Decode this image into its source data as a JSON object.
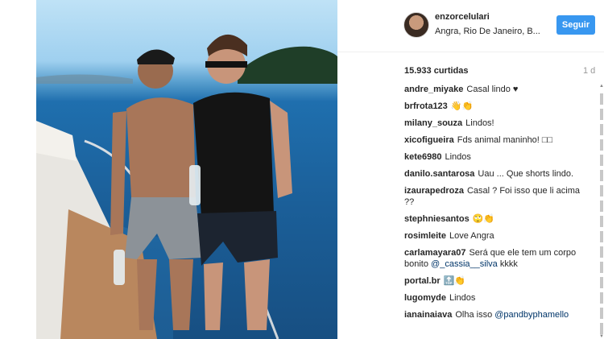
{
  "post": {
    "username": "enzorcelulari",
    "location": "Angra, Rio De Janeiro, B...",
    "follow_label": "Seguir",
    "likes": "15.933 curtidas",
    "time": "1 d"
  },
  "comments": [
    {
      "user": "andre_miyake",
      "text": "Casal lindo ♥"
    },
    {
      "user": "brfrota123",
      "text": "👋👏"
    },
    {
      "user": "milany_souza",
      "text": "Lindos!"
    },
    {
      "user": "xicofigueira",
      "text": "Fds animal maninho! □□"
    },
    {
      "user": "kete6980",
      "text": "Lindos"
    },
    {
      "user": "danilo.santarosa",
      "text": "Uau ... Que shorts lindo."
    },
    {
      "user": "izaurapedroza",
      "text": "Casal ? Foi isso que li acima ??"
    },
    {
      "user": "stephniesantos",
      "text": "🙄👏"
    },
    {
      "user": "rosimleite",
      "text": "Love Angra"
    },
    {
      "user": "carlamayara07",
      "text": "Será que ele tem um corpo bonito",
      "mention": "@_cassia__silva",
      "after": "kkkk"
    },
    {
      "user": "portal.br",
      "text": "🔝👏"
    },
    {
      "user": "lugomyde",
      "text": "Lindos"
    },
    {
      "user": "ianainaiava",
      "text": "Olha isso",
      "mention": "@pandbyphamello"
    }
  ],
  "icons": {
    "scroll_up": "scroll-up-arrow-icon",
    "scroll_down": "scroll-down-arrow-icon"
  }
}
